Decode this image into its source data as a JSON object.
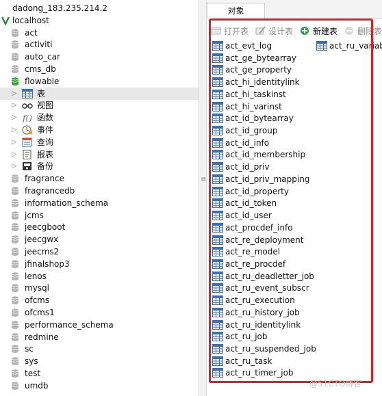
{
  "tree": {
    "connection_name": "dadong_183.235.214.2",
    "server_name": "localhost",
    "databases_before": [
      "act",
      "activiti",
      "auto_car",
      "cms_db"
    ],
    "open_database": "flowable",
    "open_children": [
      {
        "label": "表",
        "icon": "table-icon"
      },
      {
        "label": "视图",
        "icon": "view-icon"
      },
      {
        "label": "函数",
        "icon": "function-icon"
      },
      {
        "label": "事件",
        "icon": "event-icon"
      },
      {
        "label": "查询",
        "icon": "query-icon"
      },
      {
        "label": "报表",
        "icon": "report-icon"
      },
      {
        "label": "备份",
        "icon": "backup-icon"
      }
    ],
    "databases_after": [
      "fragrance",
      "fragrancedb",
      "information_schema",
      "jcms",
      "jeecgboot",
      "jeecgwx",
      "jeecms2",
      "jfinalshop3",
      "lenos",
      "mysql",
      "ofcms",
      "ofcms1",
      "performance_schema",
      "redmine",
      "sc",
      "sys",
      "test",
      "umdb"
    ]
  },
  "right": {
    "tab_label": "对象",
    "toolbar": {
      "open_table": "打开表",
      "design_table": "设计表",
      "new_table": "新建表",
      "delete_table": "删除表"
    },
    "tables_col1": [
      "act_evt_log",
      "act_ge_bytearray",
      "act_ge_property",
      "act_hi_identitylink",
      "act_hi_taskinst",
      "act_hi_varinst",
      "act_id_bytearray",
      "act_id_group",
      "act_id_info",
      "act_id_membership",
      "act_id_priv",
      "act_id_priv_mapping",
      "act_id_property",
      "act_id_token",
      "act_id_user",
      "act_procdef_info",
      "act_re_deployment",
      "act_re_model",
      "act_re_procdef",
      "act_ru_deadletter_job",
      "act_ru_event_subscr",
      "act_ru_execution",
      "act_ru_history_job",
      "act_ru_identitylink",
      "act_ru_job",
      "act_ru_suspended_job",
      "act_ru_task",
      "act_ru_timer_job"
    ],
    "tables_col2": [
      "act_ru_variab"
    ]
  },
  "watermark": "@51CTO博客",
  "colors": {
    "highlight": "#e02020",
    "db_icon": "#b5b5b5",
    "open_db_icon": "#3fa33f",
    "table_icon": "#3a6fb8",
    "new_table_icon": "#2ea043"
  }
}
